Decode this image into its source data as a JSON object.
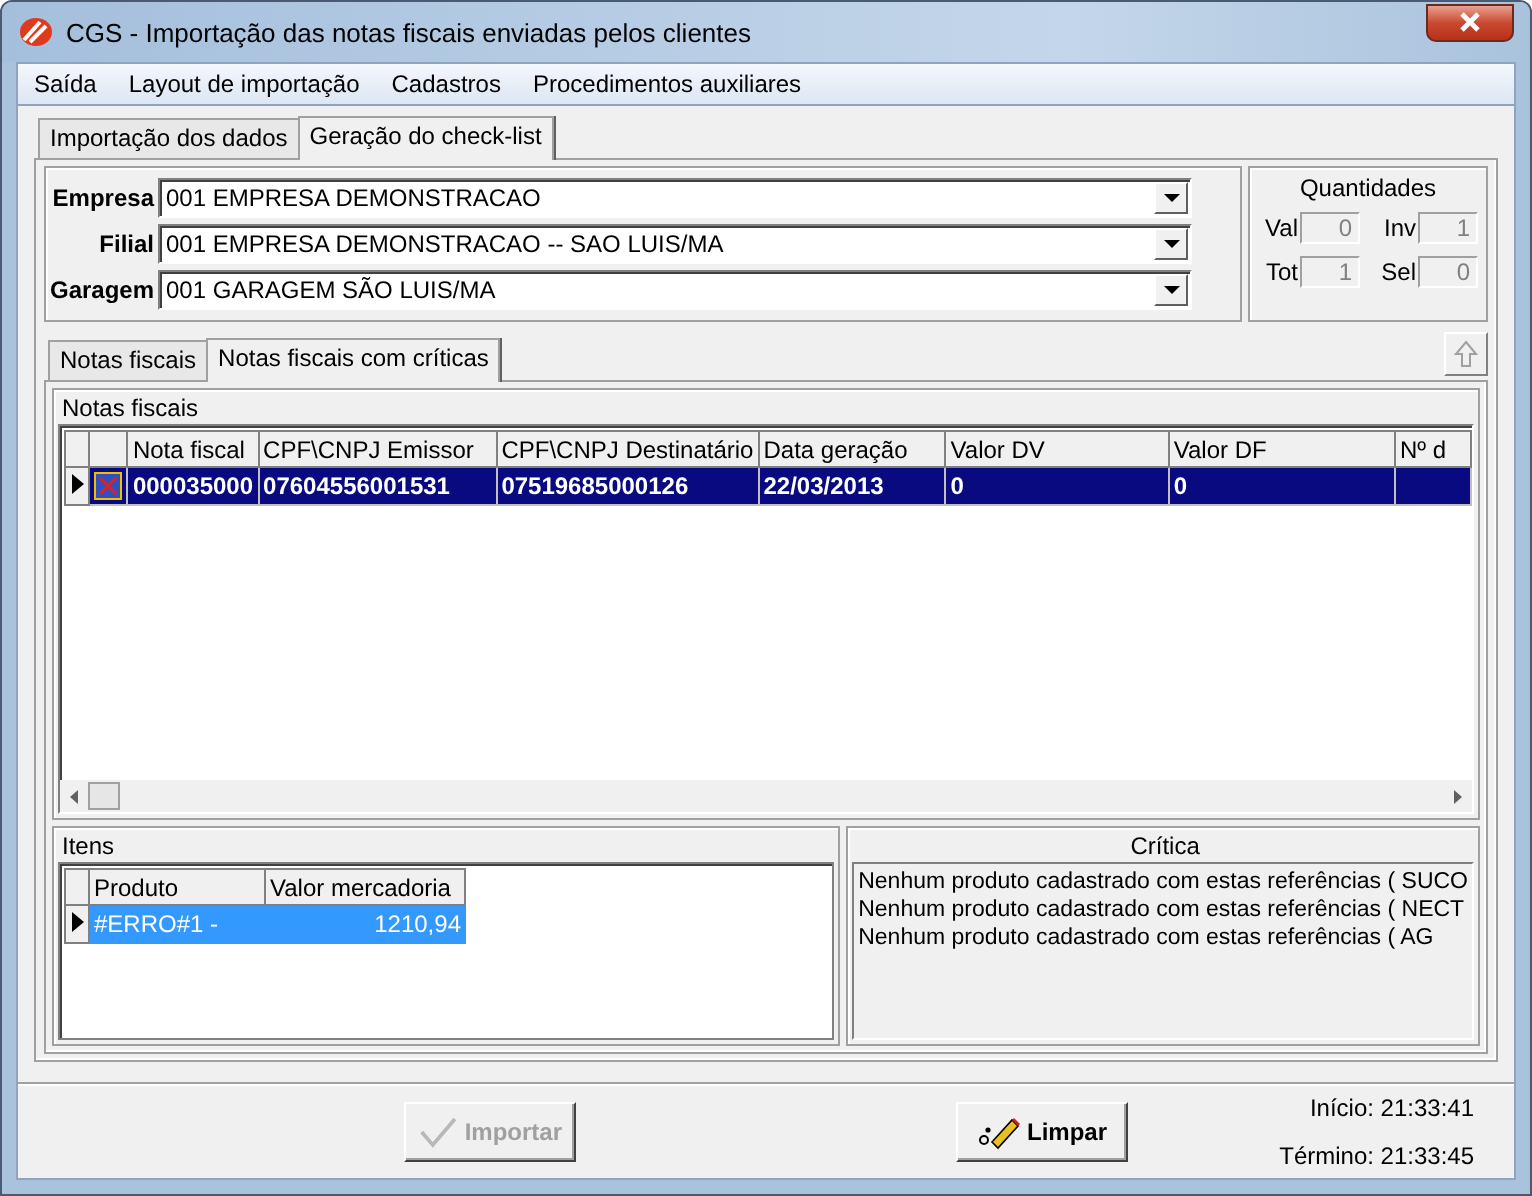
{
  "window": {
    "title": "CGS - Importação das notas fiscais enviadas pelos clientes"
  },
  "menu": [
    {
      "label": "Saída"
    },
    {
      "label": "Layout de importação"
    },
    {
      "label": "Cadastros"
    },
    {
      "label": "Procedimentos auxiliares"
    }
  ],
  "tabs": [
    {
      "label": "Importação dos dados",
      "selected": false
    },
    {
      "label": "Geração do check-list",
      "selected": true
    }
  ],
  "filters": [
    {
      "label": "Empresa",
      "value": "001 EMPRESA DEMONSTRACAO"
    },
    {
      "label": "Filial",
      "value": "001 EMPRESA DEMONSTRACAO -- SAO LUIS/MA"
    },
    {
      "label": "Garagem",
      "value": "001 GARAGEM SÃO LUIS/MA"
    }
  ],
  "quantities": {
    "title": "Quantidades",
    "fields": [
      {
        "label": "Val",
        "value": "0"
      },
      {
        "label": "Inv",
        "value": "1"
      },
      {
        "label": "Tot",
        "value": "1"
      },
      {
        "label": "Sel",
        "value": "0"
      }
    ]
  },
  "inner_tabs": [
    {
      "label": "Notas fiscais",
      "selected": false
    },
    {
      "label": "Notas fiscais com críticas",
      "selected": true
    }
  ],
  "notas": {
    "title": "Notas fiscais",
    "columns": [
      "Nota fiscal",
      "CPF\\CNPJ Emissor",
      "CPF\\CNPJ Destinatário",
      "Data geração",
      "Valor DV",
      "Valor DF",
      "Nº d"
    ],
    "rows": [
      {
        "checked": true,
        "selected": true,
        "cells": [
          "000035000",
          "07604556001531",
          "07519685000126",
          "22/03/2013",
          "0",
          "0",
          ""
        ]
      }
    ]
  },
  "itens": {
    "title": "Itens",
    "columns": [
      "Produto",
      "Valor mercadoria"
    ],
    "rows": [
      {
        "selected": true,
        "cells": [
          "#ERRO#1 -",
          "1210,94"
        ]
      }
    ]
  },
  "critica": {
    "title": "Crítica",
    "lines": [
      "Nenhum produto cadastrado com estas referências ( SUCO",
      "Nenhum produto cadastrado com estas referências ( NECT",
      "Nenhum produto cadastrado com estas referências ( AG"
    ]
  },
  "buttons": [
    {
      "kind": "import",
      "label": "Importar",
      "disabled": true
    },
    {
      "kind": "clear",
      "label": "Limpar",
      "disabled": false
    }
  ],
  "times": [
    "Início: 21:33:41",
    "Término: 21:33:45"
  ]
}
